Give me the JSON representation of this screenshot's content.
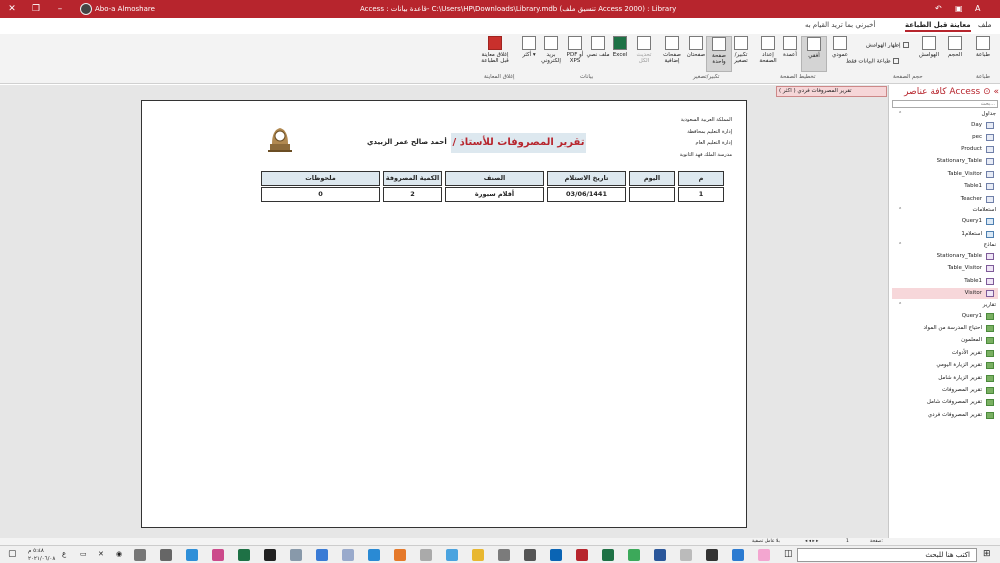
{
  "window": {
    "user": "Abo-a Almoshare",
    "title": "Access :  قاعدة بيانات- C:\\Users\\HP\\Downloads\\Library.mdb (تنسيق ملف Access 2000) : Library"
  },
  "ribbon_tabs": {
    "file": "ملف",
    "print_preview": "معاينة قبل الطباعة",
    "tell_me": "أخبرني بما تريد القيام به"
  },
  "ribbon": {
    "print": "طباعة",
    "size": "الحجم",
    "margins": "الهوامش",
    "show_margins": "إظهار الهوامش",
    "print_data_only": "طباعة البيانات فقط",
    "portrait": "عمودي",
    "landscape": "أفقي",
    "columns": "أعمدة",
    "page_setup": "إعداد الصفحة",
    "zoom": "تكبير/ تصغير",
    "one_page": "صفحة واحدة",
    "two_pages": "صفحتان",
    "more_pages": "صفحات إضافية",
    "refresh_all": "تحديث الكل",
    "excel": "Excel",
    "text_file": "ملف نصي",
    "pdf_xps": "PDF أو XPS",
    "email": "بريد إلكتروني",
    "more": "أكثر",
    "close_preview": "إغلاق معاينة قبل الطباعة",
    "groups": {
      "print": "طباعة",
      "page_size": "حجم الصفحة",
      "page_layout": "تخطيط الصفحة",
      "zoom": "تكبير/تصغير",
      "data": "بيانات",
      "close_preview": "إغلاق المعاينة"
    }
  },
  "report_tab": "تقرير المصروفات فردي ( اكثر )",
  "report": {
    "title": "تقرير المصروفات للأستاذ /",
    "person": "أحمد صالح عمر الزبيدي",
    "header_lines": [
      "المملكة العربية السعودية",
      "إدارة التعليم بمحافظة",
      "إدارة التعليم العام",
      "مدرسة الملك فهد الثانوية"
    ],
    "columns": [
      "م",
      "اليوم",
      "تاريخ الاستلام",
      "الصنف",
      "الكمية المصروفة",
      "ملحوظات"
    ],
    "row": [
      "1",
      "",
      "03/06/1441",
      "أقلام سبورة",
      "2",
      "0"
    ]
  },
  "nav": {
    "header": "كافة عناصر Access",
    "search_placeholder": "بحث...",
    "tables_label": "جداول",
    "tables": [
      "Day",
      "pec",
      "Product",
      "Stationary_Table",
      "Table_Visitor",
      "Table1",
      "Teacher"
    ],
    "queries_label": "استعلامات",
    "queries": [
      "Query1",
      "استعلام1"
    ],
    "forms_label": "نماذج",
    "forms": [
      "Stationary_Table",
      "Table_Visitor",
      "Table1",
      "Visitor"
    ],
    "reports_label": "تقارير",
    "reports": [
      "Query1",
      "احتياج المدرسة من المواد",
      "المعلمون",
      "تقرير الأدوات",
      "تقرير الزيارة اليومي",
      "تقرير الزيارة شامل",
      "تقرير المصروفات",
      "تقرير المصروفات شامل",
      "تقرير المصروفات فردي"
    ]
  },
  "statusbar": {
    "page_label": "صفحة:",
    "page_value": "1",
    "filter": "بلا عامل تصفية"
  },
  "taskbar": {
    "search": "اكتب هنا للبحث",
    "time": "٥:٤٨ م",
    "date": "٢٠٢١/٠٦/٠٨",
    "lang": "ع"
  },
  "colors": {
    "accent": "#b7252d",
    "header_fill": "#dde8ef"
  }
}
